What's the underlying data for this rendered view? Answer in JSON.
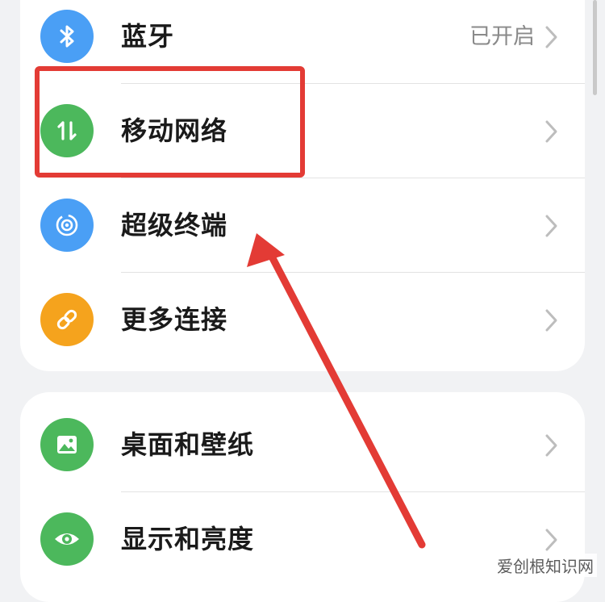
{
  "settings": {
    "items": [
      {
        "label": "蓝牙",
        "value": "已开启",
        "icon": "bluetooth-icon",
        "color": "#4a9ff5"
      },
      {
        "label": "移动网络",
        "value": "",
        "icon": "mobile-network-icon",
        "color": "#4cb85c"
      },
      {
        "label": "超级终端",
        "value": "",
        "icon": "super-device-icon",
        "color": "#4a9ff5"
      },
      {
        "label": "更多连接",
        "value": "",
        "icon": "link-icon",
        "color": "#f5a31d"
      },
      {
        "label": "桌面和壁纸",
        "value": "",
        "icon": "wallpaper-icon",
        "color": "#4cb85c"
      },
      {
        "label": "显示和亮度",
        "value": "",
        "icon": "eye-icon",
        "color": "#4cb85c"
      }
    ]
  },
  "annotation": {
    "highlight_color": "#e33b35"
  },
  "watermark": "爱创根知识网"
}
